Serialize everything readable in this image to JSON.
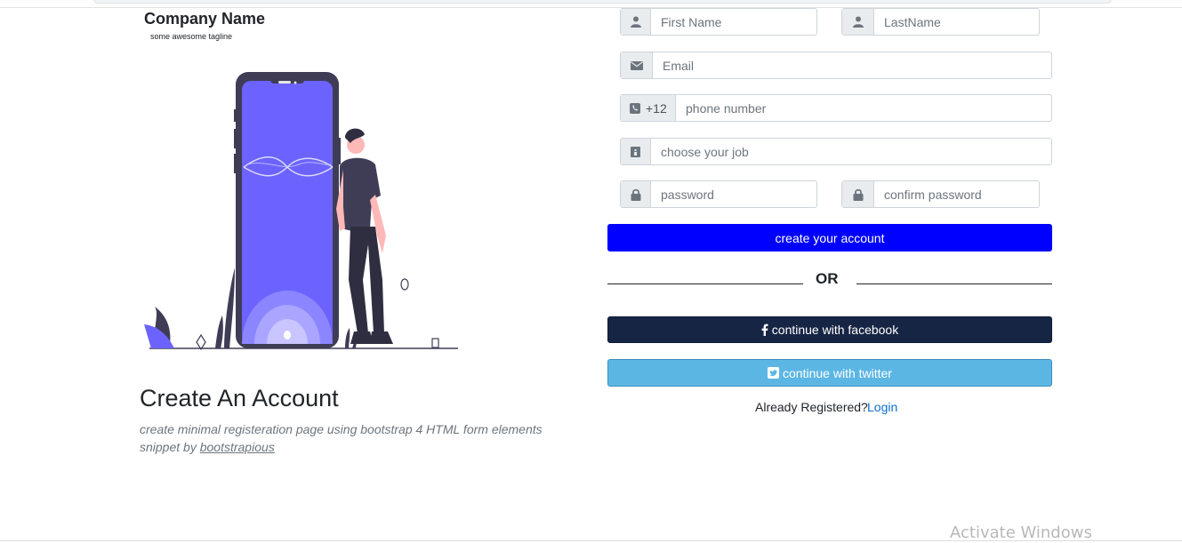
{
  "brand": {
    "name": "Company Name",
    "tagline": "some awesome tagline"
  },
  "hero": {
    "title": "Create An Account",
    "subtitle_text": "create minimal registeration page using bootstrap 4 HTML form elements snippet by",
    "subtitle_link": "bootstrapious"
  },
  "form": {
    "first_name": {
      "placeholder": "First Name",
      "icon": "user-icon"
    },
    "last_name": {
      "placeholder": "LastName",
      "icon": "user-icon"
    },
    "email": {
      "placeholder": "Email",
      "icon": "envelope-icon"
    },
    "phone": {
      "code": "+12",
      "placeholder": "phone number",
      "icon": "phone-icon"
    },
    "job": {
      "placeholder": "choose your job",
      "icon": "id-card-icon"
    },
    "password": {
      "placeholder": "password",
      "icon": "lock-icon"
    },
    "confirm_password": {
      "placeholder": "confirm password",
      "icon": "lock-icon"
    },
    "create_button": "create your account",
    "or_text": "OR",
    "facebook_button": "continue with facebook",
    "twitter_button": "continue with twitter",
    "already_text": "Already Registered?",
    "login_link": "Login"
  },
  "colors": {
    "primary": "#0000ff",
    "facebook": "#172545",
    "twitter": "#5cb6e4",
    "phone_screen": "#6c63ff"
  },
  "watermark": "Activate Windows"
}
